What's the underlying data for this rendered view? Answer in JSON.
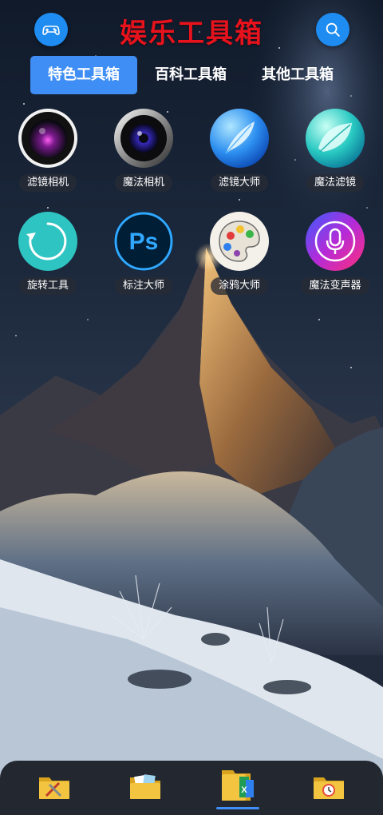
{
  "header": {
    "title": "娱乐工具箱",
    "left_icon": "gamepad-icon",
    "right_icon": "search-icon",
    "title_color": "#e8121c",
    "button_color": "#1e8cf0"
  },
  "tabs": [
    {
      "label": "特色工具箱",
      "active": true
    },
    {
      "label": "百科工具箱",
      "active": false
    },
    {
      "label": "其他工具箱",
      "active": false
    }
  ],
  "tools": [
    {
      "label": "滤镜相机",
      "icon": "camera-lens-purple-icon"
    },
    {
      "label": "魔法相机",
      "icon": "camera-lens-blue-icon"
    },
    {
      "label": "滤镜大师",
      "icon": "feather-icon"
    },
    {
      "label": "魔法滤镜",
      "icon": "leaf-icon"
    },
    {
      "label": "旋转工具",
      "icon": "rotate-icon"
    },
    {
      "label": "标注大师",
      "icon": "ps-icon",
      "icon_text": "Ps"
    },
    {
      "label": "涂鸦大师",
      "icon": "palette-icon"
    },
    {
      "label": "魔法变声器",
      "icon": "microphone-icon"
    }
  ],
  "bottom_nav": [
    {
      "icon": "tools-folder-icon",
      "active": false
    },
    {
      "icon": "photos-folder-icon",
      "active": false
    },
    {
      "icon": "office-folder-icon",
      "active": true
    },
    {
      "icon": "clock-folder-icon",
      "active": false
    }
  ],
  "accent_color": "#3f8ef5"
}
